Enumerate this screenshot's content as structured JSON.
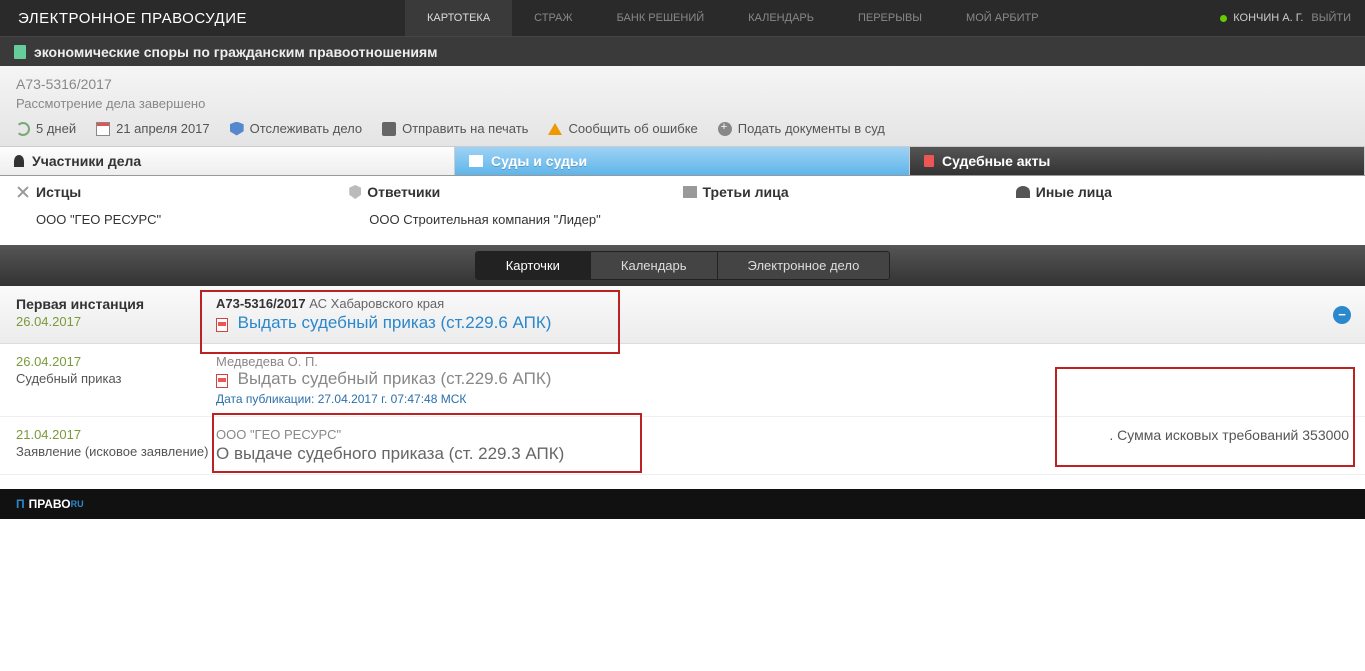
{
  "brand": "ЭЛЕКТРОННОЕ ПРАВОСУДИЕ",
  "nav": {
    "kartoteka": "КАРТОТЕКА",
    "strazh": "СТРАЖ",
    "bank": "БАНК РЕШЕНИЙ",
    "kalendar": "КАЛЕНДАРЬ",
    "pereryvy": "ПЕРЕРЫВЫ",
    "moyarbitr": "МОЙ АРБИТР"
  },
  "user": {
    "name": "КОНЧИН А. Г.",
    "logout": "ВЫЙТИ"
  },
  "subheader": "экономические споры по гражданским правоотношениям",
  "case": {
    "number": "А73-5316/2017",
    "status": "Рассмотрение дела завершено"
  },
  "actions": {
    "days": "5 дней",
    "date": "21 апреля 2017",
    "track": "Отслеживать дело",
    "print": "Отправить на печать",
    "error": "Сообщить об ошибке",
    "submit": "Подать документы в суд"
  },
  "sectabs": {
    "participants": "Участники дела",
    "courts": "Суды и судьи",
    "acts": "Судебные акты"
  },
  "parties": {
    "plaintiffs": {
      "h": "Истцы",
      "v": "ООО \"ГЕО РЕСУРС\""
    },
    "defendants": {
      "h": "Ответчики",
      "v": "ООО Строительная компания \"Лидер\""
    },
    "third": {
      "h": "Третьи лица"
    },
    "other": {
      "h": "Иные лица"
    }
  },
  "pills": {
    "cards": "Карточки",
    "calendar": "Календарь",
    "edoc": "Электронное дело"
  },
  "instance": {
    "title": "Первая инстанция",
    "date": "26.04.2017",
    "casenum": "А73-5316/2017",
    "court": "АС Хабаровского края",
    "link": "Выдать судебный приказ (ст.229.6 АПК)"
  },
  "row1": {
    "date": "26.04.2017",
    "type": "Судебный приказ",
    "judge": "Медведева О. П.",
    "link": "Выдать судебный приказ (ст.229.6 АПК)",
    "pub": "Дата публикации: 27.04.2017 г. 07:47:48 МСК"
  },
  "row2": {
    "date": "21.04.2017",
    "type": "Заявление (исковое заявление)",
    "party": "ООО \"ГЕО РЕСУРС\"",
    "title": "О выдаче судебного приказа (ст. 229.3 АПК)",
    "sum": ". Сумма исковых требований 353000"
  },
  "footer": {
    "brand": "ПРАВО",
    "ru": "RU"
  }
}
